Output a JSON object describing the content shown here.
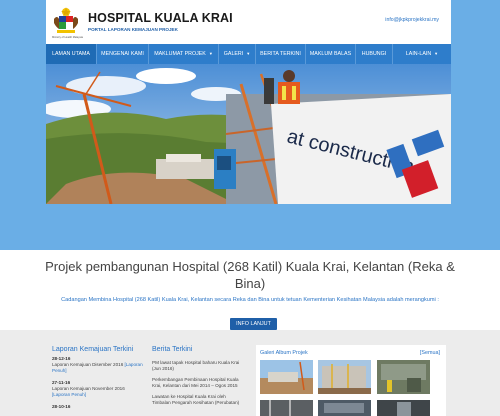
{
  "header": {
    "title": "HOSPITAL KUALA KRAI",
    "subtitle": "PORTAL LAPORAN KEMAJUAN PROJEK",
    "ministry": "Ministry of Health Malaysia",
    "email": "info@jkpkprojekkrai.my"
  },
  "nav": {
    "items": [
      {
        "label": "LAMAN UTAMA",
        "dropdown": false
      },
      {
        "label": "MENGENAI KAMI",
        "dropdown": false
      },
      {
        "label": "MAKLUMAT PROJEK",
        "dropdown": true
      },
      {
        "label": "GALERI",
        "dropdown": true
      },
      {
        "label": "BERITA TERKINI",
        "dropdown": false
      },
      {
        "label": "MAKLUM BALAS",
        "dropdown": false
      },
      {
        "label": "HUBUNGI",
        "dropdown": false
      },
      {
        "label": "LAIN-LAIN",
        "dropdown": true
      }
    ]
  },
  "hero": {
    "banner_text": "at construction"
  },
  "intro": {
    "title": "Projek pembangunan Hospital (268 Katil) Kuala Krai, Kelantan (Reka & Bina)",
    "description": "Cadangan Membina Hospital (268 Katil) Kuala Krai, Kelantan secara Reka dan Bina untuk tetuan Kementerian Kesihatan Malaysia adalah merangkumi :",
    "button": "INFO LANJUT"
  },
  "reports": {
    "heading": "Laporan Kemajuan Terkini",
    "items": [
      {
        "date": "28-12-16",
        "text": "Laporan Kemajuan Disember 2016",
        "link": "[Laporan Penuh]"
      },
      {
        "date": "27-11-16",
        "text": "Laporan Kemajuan November 2016",
        "link": "[Laporan Penuh]"
      },
      {
        "date": "28-10-16",
        "text": "",
        "link": ""
      }
    ]
  },
  "news": {
    "heading": "Berita Terkini",
    "items": [
      "PM lawat tapak Hospital baharu Kuala Krai (Jun 2016)",
      "Perkembangan Pembinaan Hospital Kuala Krai, Kelantan dari Mei 2014 – Ogos 2015",
      "Lawatan ke Hospital Kuala Krai oleh Timbalan Pengarah Kesihatan (Perubatan)"
    ]
  },
  "gallery": {
    "title": "Galeri Album Projek",
    "view_all": "[Semua]"
  },
  "colors": {
    "brand_blue": "#2e7dcb",
    "dark_blue": "#1f5fa8",
    "link_blue": "#2a74c5",
    "background_blue": "#3d8bd3"
  }
}
